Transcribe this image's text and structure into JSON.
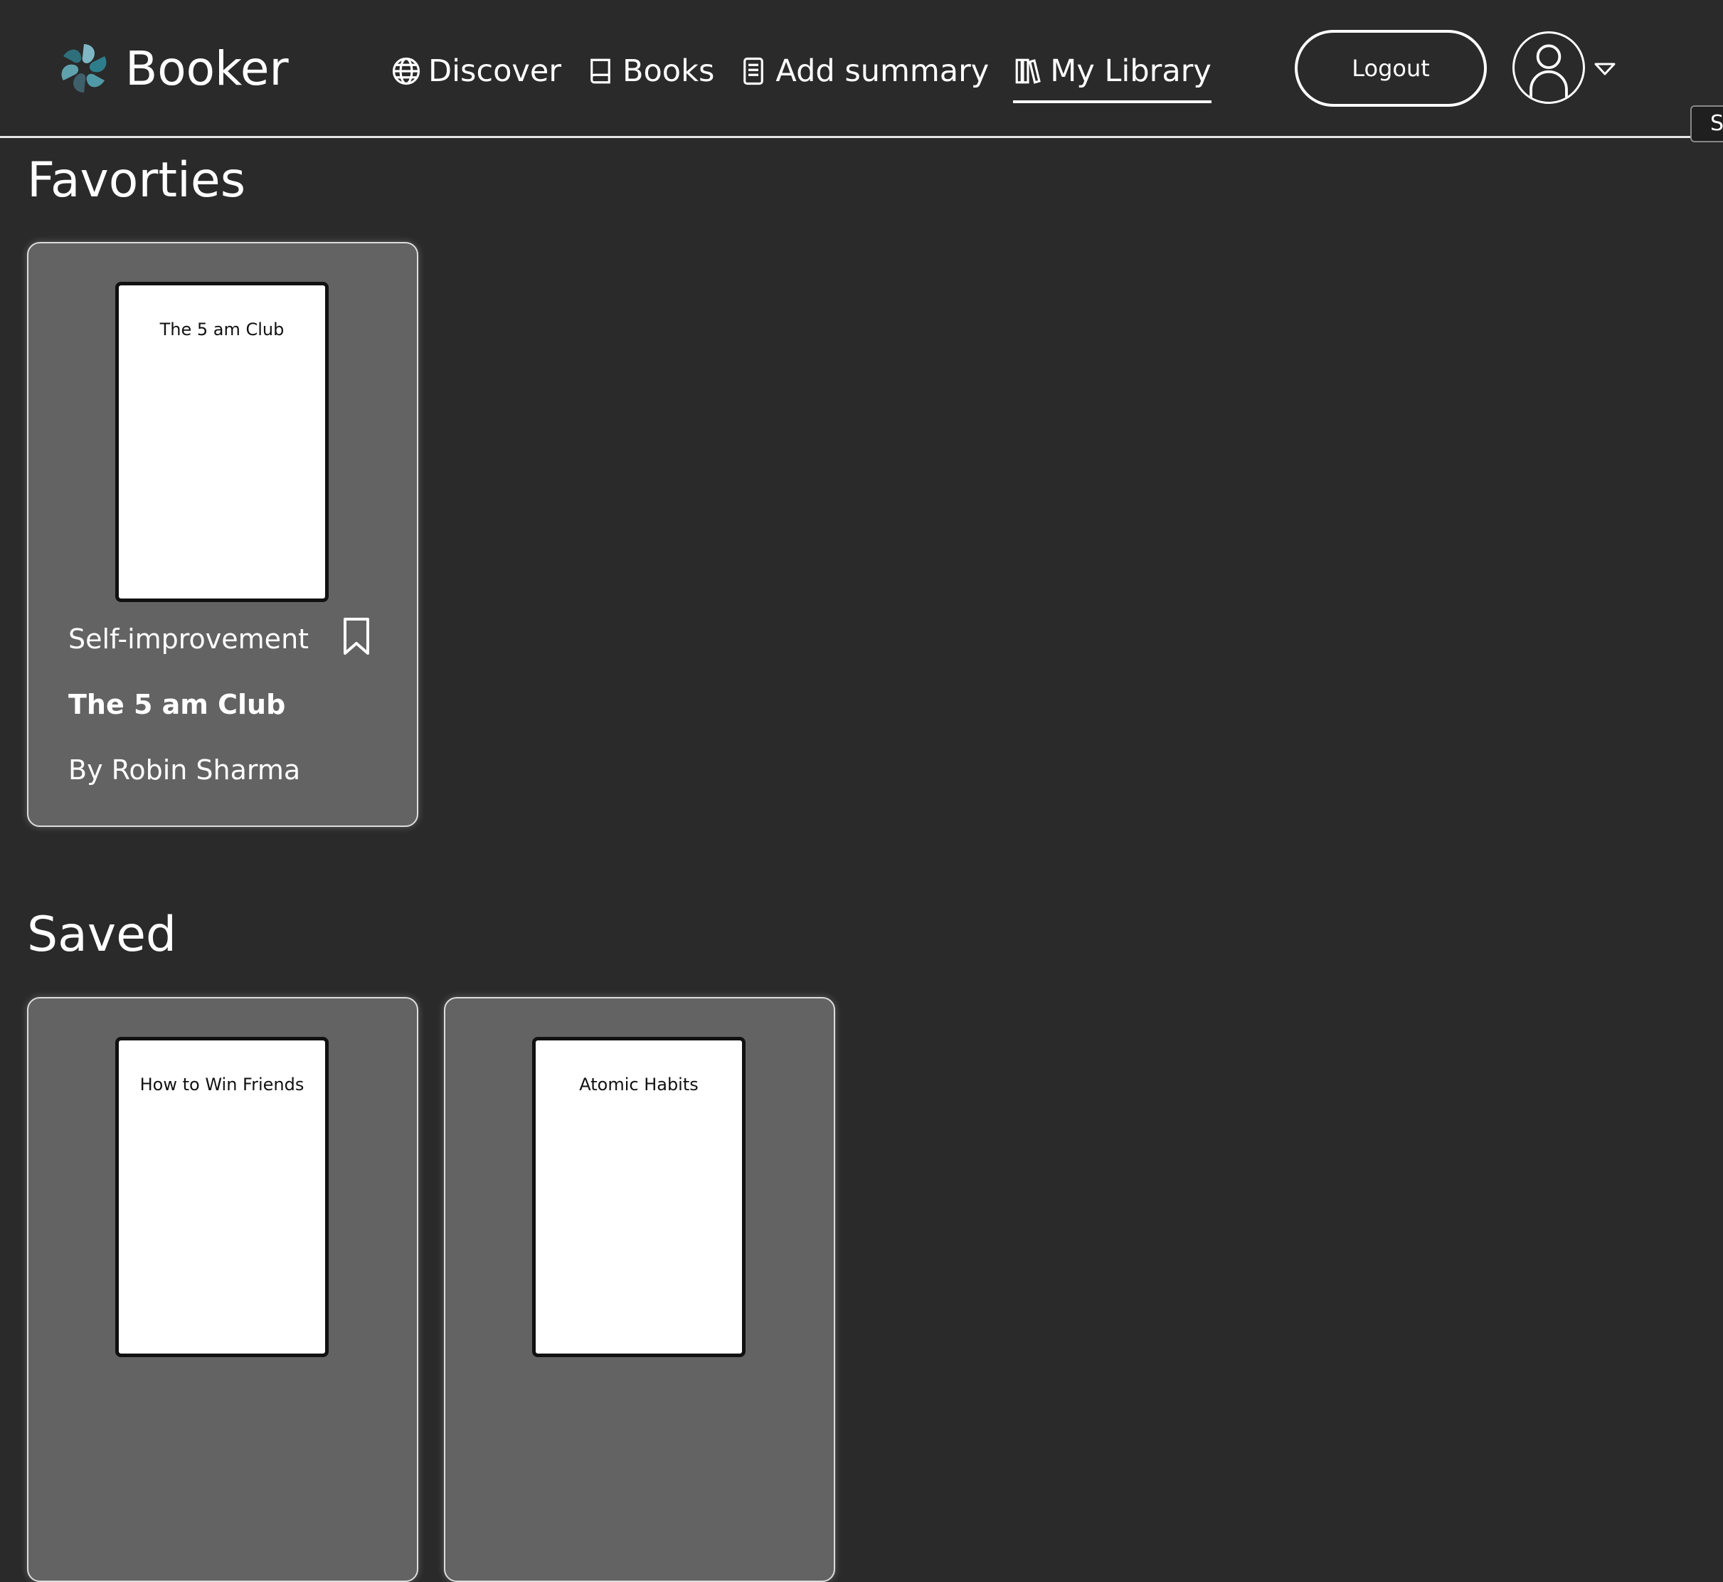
{
  "app": {
    "name": "Booker",
    "brand_colors": [
      "#2e7d8c",
      "#7fb8c4",
      "#3f5f6a"
    ]
  },
  "nav": {
    "items": [
      {
        "label": "Discover",
        "icon": "globe-icon"
      },
      {
        "label": "Books",
        "icon": "book-icon"
      },
      {
        "label": "Add summary",
        "icon": "document-icon"
      },
      {
        "label": "My Library",
        "icon": "library-icon",
        "active": true
      }
    ],
    "logout_label": "Logout",
    "avatar_icon": "user-icon",
    "dropdown_icon": "caret-down-icon",
    "side_tab_label": "S"
  },
  "favorites": {
    "title": "Favorties",
    "books": [
      {
        "cover_text": "The 5 am Club",
        "genre": "Self-improvement",
        "title": "The 5 am Club",
        "author": "By Robin Sharma",
        "icon": "bookmark-icon"
      }
    ]
  },
  "saved": {
    "title": "Saved",
    "books": [
      {
        "cover_text": "How to Win Friends"
      },
      {
        "cover_text": "Atomic Habits"
      }
    ]
  },
  "colors": {
    "background": "#2a2a2a",
    "card": "#636363",
    "text": "#ffffff"
  }
}
